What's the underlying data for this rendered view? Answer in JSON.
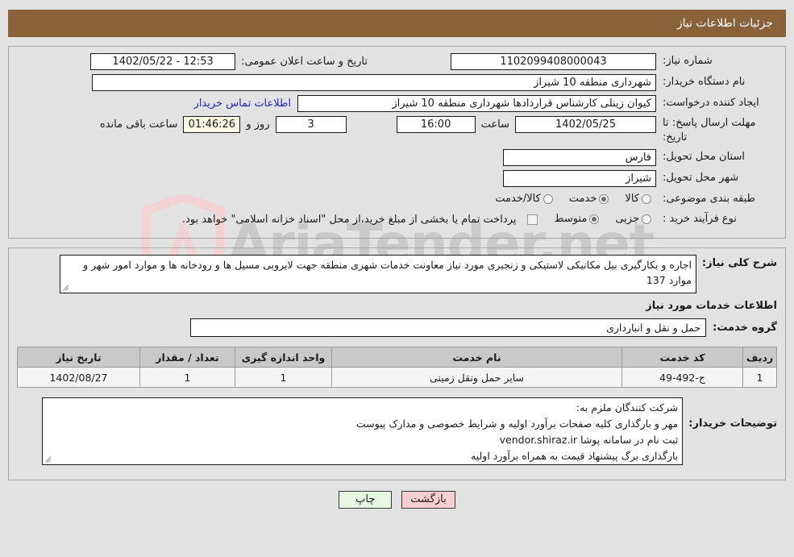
{
  "header": {
    "title": "جزئیات اطلاعات نیاز",
    "bg_color": "#8a6239",
    "text_color": "#ffffff"
  },
  "watermark": {
    "text": "AriaTender.net",
    "shield_color": "#f0cfd1",
    "text_color": "#c9c9c9"
  },
  "form": {
    "need_number_label": "شماره نیاز:",
    "need_number_value": "1102099408000043",
    "announce_datetime_label": "تاریخ و ساعت اعلان عمومی:",
    "announce_datetime_value": "12:53 - 1402/05/22",
    "buyer_org_label": "نام دستگاه خریدار:",
    "buyer_org_value": "شهرداری منطقه 10 شیراز",
    "creator_label": "ایجاد کننده درخواست:",
    "creator_value": "کیوان زینلی کارشناس قراردادها شهرداری منطقه 10 شیراز",
    "contact_link": "اطلاعات تماس خریدار",
    "deadline_label": "مهلت ارسال پاسخ: تا تاریخ:",
    "deadline_date": "1402/05/25",
    "deadline_hour_label": "ساعت",
    "deadline_hour": "16:00",
    "remaining_days": "3",
    "remaining_days_label": "روز و",
    "remaining_time": "01:46:26",
    "remaining_time_label": "ساعت باقی مانده",
    "province_label": "استان محل تحویل:",
    "province_value": "فارس",
    "city_label": "شهر محل تحویل:",
    "city_value": "شیراز",
    "category_label": "طبقه بندی موضوعی:",
    "category_options": [
      {
        "label": "کالا",
        "selected": false
      },
      {
        "label": "خدمت",
        "selected": true
      },
      {
        "label": "کالا/خدمت",
        "selected": false
      }
    ],
    "process_type_label": "نوع فرآیند خرید :",
    "process_type_options": [
      {
        "label": "جزیی",
        "selected": false
      },
      {
        "label": "متوسط",
        "selected": true
      }
    ],
    "treasury_checkbox_checked": false,
    "treasury_note": "پرداخت تمام یا بخشی از مبلغ خرید،از محل \"اسناد خزانه اسلامی\" خواهد بود."
  },
  "description": {
    "label": "شرح کلی نیاز:",
    "value": "اجاره و بکارگیری بیل مکانیکی لاستیکی و زنجیری مورد نیاز معاونت خدمات شهری منطقه جهت لایروبی مسیل ها و رودخانه ها و موارد امور شهر  و موارد 137"
  },
  "services_section": {
    "heading": "اطلاعات خدمات مورد نیاز",
    "group_label": "گروه خدمت:",
    "group_value": "حمل و نقل و انبارداری",
    "table": {
      "columns": [
        "ردیف",
        "کد خدمت",
        "نام خدمت",
        "واحد اندازه گیری",
        "تعداد / مقدار",
        "تاریخ نیاز"
      ],
      "rows": [
        [
          "1",
          "ح-492-49",
          "سایر حمل ونقل زمینی",
          "1",
          "1",
          "1402/08/27"
        ]
      ]
    }
  },
  "buyer_notes": {
    "label": "توضیحات خریدار:",
    "value": "شرکت کنندگان ملزم به:\nمهر و بارگذاری کلیه صفحات برآورد اولیه و شرایط خصوصی و مدارک پیوست\nثبت نام در سامانه پوشا vendor.shiraz.ir\nبارگذاری برگ پیشنهاد قیمت به همراه برآورد اولیه"
  },
  "buttons": {
    "print": "چاپ",
    "back": "بازگشت",
    "print_bg": "#e8f6e4",
    "back_bg": "#f9cfd2"
  }
}
